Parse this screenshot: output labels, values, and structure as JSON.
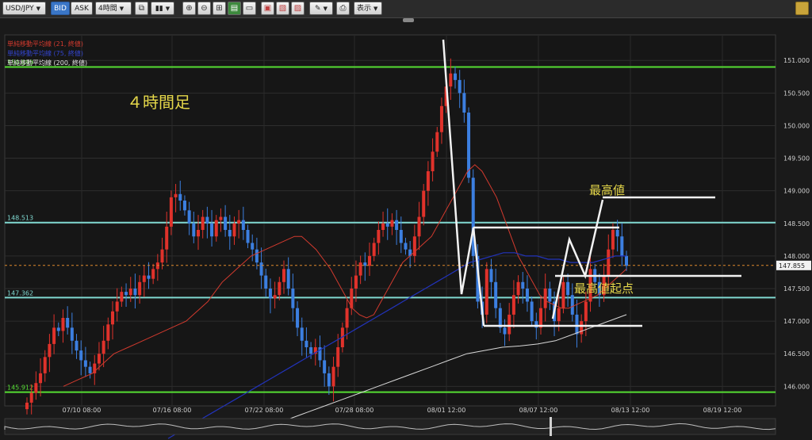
{
  "toolbar": {
    "symbol": "USD/JPY",
    "bid_label": "BID",
    "ask_label": "ASK",
    "timeframe": "4時間",
    "display_label": "表示"
  },
  "indicators": [
    {
      "label": "単純移動平均線 (21, 終値)",
      "color": "#d23a2e"
    },
    {
      "label": "単純移動平均線 (75, 終値)",
      "color": "#2233bb"
    },
    {
      "label": "単純移動平均線 (200, 終値)",
      "color": "#e6e6e6"
    }
  ],
  "annotations": {
    "title": "４時間足",
    "highest_price": "最高値",
    "highest_start": "最高値起点"
  },
  "levels": {
    "l1": "150.899",
    "l2": "148.513",
    "l3": "147.362",
    "l4": "145.912",
    "current": "147.855"
  },
  "colors": {
    "up": "#e0322b",
    "down": "#3c7fe0",
    "green_line": "#55dd33",
    "cyan_line": "#7fd8d0",
    "current": "#e08a2c",
    "text_yellow": "#e6d84a"
  },
  "chart_data": {
    "type": "candlestick",
    "title": "",
    "y_ticks": [
      "151.000",
      "150.500",
      "150.000",
      "149.500",
      "149.000",
      "148.500",
      "148.000",
      "147.500",
      "147.000",
      "146.500",
      "146.000"
    ],
    "x_ticks": [
      "07/10 08:00",
      "07/16 08:00",
      "07/22 08:00",
      "07/28 08:00",
      "08/01 12:00",
      "08/07 12:00",
      "08/13 12:00",
      "08/19 12:00"
    ],
    "ylim": [
      145.7,
      151.1
    ],
    "horizontal_levels": [
      150.899,
      148.513,
      147.362,
      145.912
    ],
    "current_price": 147.855,
    "closes": [
      145.75,
      145.9,
      146.05,
      146.2,
      146.45,
      146.65,
      146.9,
      146.85,
      147.05,
      146.9,
      146.7,
      146.55,
      146.4,
      146.3,
      146.2,
      146.35,
      146.5,
      146.7,
      146.95,
      147.15,
      147.3,
      147.45,
      147.4,
      147.5,
      147.4,
      147.6,
      147.7,
      147.65,
      147.8,
      147.9,
      148.1,
      148.45,
      148.9,
      148.95,
      148.85,
      148.7,
      148.5,
      148.3,
      148.4,
      148.6,
      148.5,
      148.3,
      148.55,
      148.6,
      148.4,
      148.3,
      148.5,
      148.55,
      148.4,
      148.2,
      148.1,
      147.9,
      147.7,
      147.5,
      147.35,
      147.4,
      147.6,
      147.8,
      147.5,
      147.2,
      146.9,
      146.7,
      146.6,
      146.5,
      146.6,
      146.4,
      146.2,
      146.0,
      146.3,
      146.6,
      146.9,
      147.2,
      147.5,
      147.7,
      147.9,
      147.85,
      148.0,
      148.2,
      148.4,
      148.5,
      148.45,
      148.55,
      148.4,
      148.2,
      148.1,
      148.0,
      148.3,
      148.6,
      149.0,
      149.3,
      149.6,
      149.9,
      150.3,
      150.6,
      150.8,
      150.7,
      150.5,
      150.2,
      149.2,
      148.0,
      147.3,
      147.1,
      147.8,
      147.6,
      147.2,
      146.9,
      146.8,
      147.1,
      147.4,
      147.6,
      147.5,
      147.3,
      147.0,
      146.9,
      147.2,
      147.5,
      147.3,
      147.0,
      147.2,
      147.6,
      147.4,
      147.1,
      146.8,
      147.0,
      147.3,
      147.8,
      147.6,
      147.4,
      147.7,
      148.1,
      148.4,
      148.3,
      148.0,
      147.85
    ],
    "ma21": [
      146.0,
      146.05,
      146.1,
      146.15,
      146.2,
      146.3,
      146.4,
      146.5,
      146.55,
      146.6,
      146.65,
      146.7,
      146.75,
      146.8,
      146.85,
      146.9,
      146.95,
      147.0,
      147.1,
      147.2,
      147.3,
      147.45,
      147.6,
      147.7,
      147.8,
      147.9,
      148.0,
      148.05,
      148.1,
      148.15,
      148.2,
      148.25,
      148.3,
      148.3,
      148.2,
      148.1,
      147.95,
      147.8,
      147.6,
      147.4,
      147.2,
      147.1,
      147.05,
      147.1,
      147.3,
      147.5,
      147.7,
      147.9,
      148.0,
      148.1,
      148.2,
      148.3,
      148.5,
      148.7,
      148.9,
      149.1,
      149.3,
      149.4,
      149.3,
      149.1,
      148.9,
      148.6,
      148.3,
      148.0,
      147.8,
      147.6,
      147.4,
      147.3,
      147.25,
      147.2,
      147.2,
      147.25,
      147.3,
      147.35,
      147.4,
      147.5,
      147.6,
      147.7,
      147.8
    ],
    "ma75": [
      145.2,
      145.3,
      145.4,
      145.5,
      145.6,
      145.7,
      145.8,
      145.9,
      146.0,
      146.1,
      146.2,
      146.3,
      146.4,
      146.5,
      146.6,
      146.7,
      146.8,
      146.9,
      147.0,
      147.1,
      147.2,
      147.3,
      147.4,
      147.5,
      147.6,
      147.7,
      147.8,
      147.9,
      147.95,
      148.0,
      148.05,
      148.05,
      148.0,
      148.0,
      147.95,
      147.95,
      147.9,
      147.9,
      147.9,
      147.95,
      148.0,
      148.0
    ],
    "ma200": [
      145.3,
      145.4,
      145.5,
      145.6,
      145.7,
      145.8,
      145.9,
      146.0,
      146.1,
      146.2,
      146.3,
      146.4,
      146.5,
      146.55,
      146.6,
      146.62,
      146.65,
      146.7,
      146.8,
      146.9,
      147.0,
      147.1
    ]
  }
}
